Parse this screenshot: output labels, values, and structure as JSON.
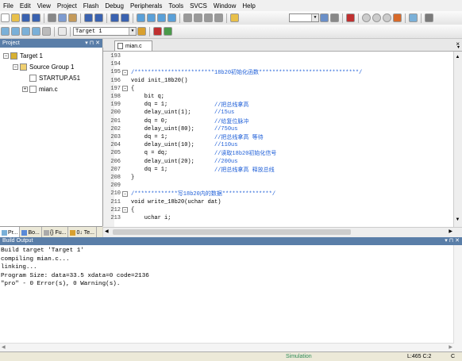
{
  "menu": [
    "File",
    "Edit",
    "View",
    "Project",
    "Flash",
    "Debug",
    "Peripherals",
    "Tools",
    "SVCS",
    "Window",
    "Help"
  ],
  "toolbar2": {
    "target": "Target 1"
  },
  "project_panel": {
    "title": "Project",
    "tree": [
      {
        "label": "Target 1",
        "indent": 0,
        "expand": "⊟",
        "icon": "target-icon"
      },
      {
        "label": "Source Group 1",
        "indent": 1,
        "expand": "⊟",
        "icon": "folder-icon"
      },
      {
        "label": "STARTUP.A51",
        "indent": 2,
        "expand": "",
        "icon": "asm-file-icon"
      },
      {
        "label": "mian.c",
        "indent": 2,
        "expand": "⊞",
        "icon": "c-file-icon"
      }
    ],
    "tabs": [
      "Pr...",
      "Bo...",
      "{} Fu...",
      "0↓ Te..."
    ]
  },
  "editor": {
    "tab_label": "mian.c",
    "lines": [
      {
        "n": "193",
        "f": "",
        "code": "",
        "c": ""
      },
      {
        "n": "194",
        "f": "",
        "code": "",
        "c": ""
      },
      {
        "n": "195",
        "f": "-",
        "code": "",
        "c": "/************************18b20初始化函数******************************/"
      },
      {
        "n": "196",
        "f": "",
        "code": "void init_18b20()",
        "c": ""
      },
      {
        "n": "197",
        "f": "-",
        "code": "{",
        "c": ""
      },
      {
        "n": "198",
        "f": "",
        "code": "    bit q;",
        "c": ""
      },
      {
        "n": "199",
        "f": "",
        "code": "    dq = 1;              ",
        "c": "//把总线拿高"
      },
      {
        "n": "200",
        "f": "",
        "code": "    delay_uint(1);       ",
        "c": "//15us"
      },
      {
        "n": "201",
        "f": "",
        "code": "    dq = 0;              ",
        "c": "//给复位脉冲"
      },
      {
        "n": "202",
        "f": "",
        "code": "    delay_uint(80);      ",
        "c": "//750us"
      },
      {
        "n": "203",
        "f": "",
        "code": "    dq = 1;              ",
        "c": "//把总线拿高 等待"
      },
      {
        "n": "204",
        "f": "",
        "code": "    delay_uint(10);      ",
        "c": "//110us"
      },
      {
        "n": "205",
        "f": "",
        "code": "    q = dq;              ",
        "c": "//读取18b20初始化信号"
      },
      {
        "n": "206",
        "f": "",
        "code": "    delay_uint(20);      ",
        "c": "//200us"
      },
      {
        "n": "207",
        "f": "",
        "code": "    dq = 1;              ",
        "c": "//把总线拿高 释放总线"
      },
      {
        "n": "208",
        "f": "",
        "code": "}",
        "c": ""
      },
      {
        "n": "209",
        "f": "",
        "code": "",
        "c": ""
      },
      {
        "n": "210",
        "f": "-",
        "code": "",
        "c": "/*************写18b20内的数据***************/"
      },
      {
        "n": "211",
        "f": "",
        "code": "void write_18b20(uchar dat)",
        "c": ""
      },
      {
        "n": "212",
        "f": "-",
        "code": "{",
        "c": ""
      },
      {
        "n": "213",
        "f": "",
        "code": "    uchar i;",
        "c": ""
      }
    ]
  },
  "build_output": {
    "title": "Build Output",
    "text": "Build target 'Target 1'\ncompiling mian.c...\nlinking...\nProgram Size: data=33.5 xdata=0 code=2136\n\"pro\" - 0 Error(s), 0 Warning(s)."
  },
  "status": {
    "mode": "Simulation",
    "position": "L:465 C:2",
    "caps": "C"
  },
  "colors": {
    "accent": "#5a7ea8",
    "comment": "#2060d8",
    "status_mode": "#2e8b57"
  }
}
